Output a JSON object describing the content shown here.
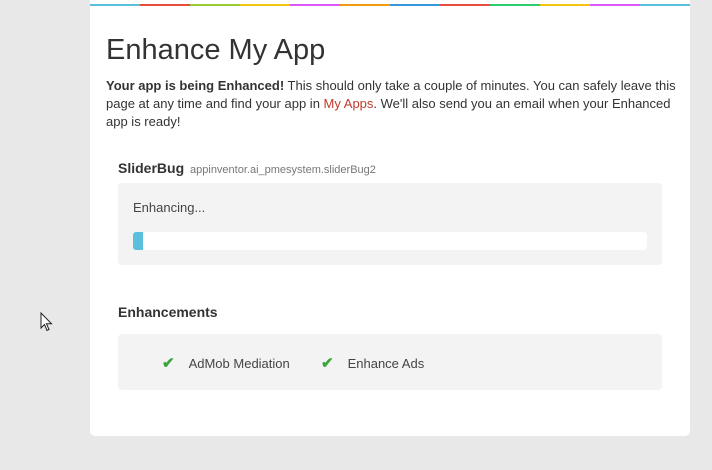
{
  "page": {
    "title": "Enhance My App",
    "intro_bold": "Your app is being Enhanced!",
    "intro_part1": " This should only take a couple of minutes. You can safely leave this page at any time and find your app in ",
    "intro_link": "My Apps",
    "intro_part2": ". We'll also send you an email when your Enhanced app is ready!"
  },
  "app": {
    "name": "SliderBug",
    "id": "appinventor.ai_pmesystem.sliderBug2"
  },
  "status": {
    "text": "Enhancing...",
    "progress_percent": 2
  },
  "enhancements": {
    "title": "Enhancements",
    "items": [
      {
        "label": "AdMob Mediation"
      },
      {
        "label": "Enhance Ads"
      }
    ]
  },
  "colors": {
    "accent_link": "#c0392b",
    "progress": "#5bc0de",
    "check": "#3aa63a",
    "stripe": [
      "#5bc0de",
      "#e74c3c",
      "#9acd32",
      "#f1c40f",
      "#e056fd",
      "#f39c12",
      "#3498db",
      "#e74c3c",
      "#2ecc71",
      "#f1c40f",
      "#e056fd",
      "#5bc0de"
    ]
  }
}
